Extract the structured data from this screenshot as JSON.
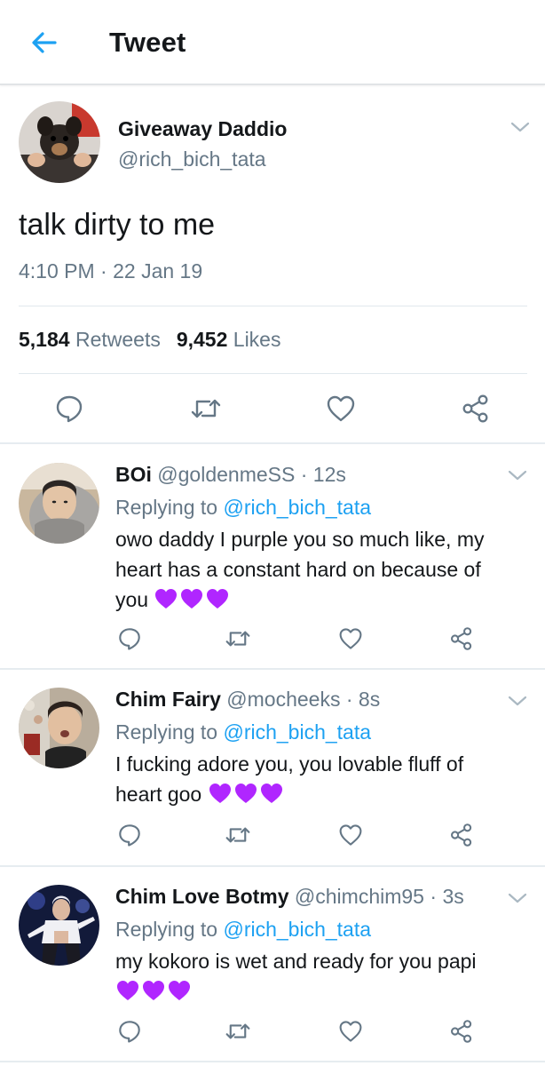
{
  "header": {
    "title": "Tweet",
    "back_icon": "arrow-left-icon"
  },
  "main_tweet": {
    "name": "Giveaway Daddio",
    "handle": "@rich_bich_tata",
    "text": "talk dirty to me",
    "time": "4:10 PM",
    "separator": "·",
    "date": "22 Jan 19",
    "retweets_count": "5,184",
    "retweets_label": "Retweets",
    "likes_count": "9,452",
    "likes_label": "Likes"
  },
  "replies": [
    {
      "name": "BOi",
      "handle": "@goldenmeSS",
      "age": "12s",
      "replying_prefix": "Replying to",
      "replying_handle": "@rich_bich_tata",
      "line1": "owo daddy I purple you so much like, my",
      "line2": "heart has a constant hard on because of",
      "line3": "you",
      "emoji": "purple-heart x3"
    },
    {
      "name": "Chim Fairy",
      "handle": "@mocheeks",
      "age": "8s",
      "replying_prefix": "Replying to",
      "replying_handle": "@rich_bich_tata",
      "line1": "I fucking adore you, you lovable fluff of",
      "line2": "heart goo",
      "emoji": "purple-heart x3"
    },
    {
      "name": "Chim Love Botmy",
      "handle": "@chimchim95",
      "age": "3s",
      "replying_prefix": "Replying to",
      "replying_handle": "@rich_bich_tata",
      "line1": "my kokoro is wet and ready for you papi",
      "emoji": "purple-heart x3"
    }
  ],
  "colors": {
    "accent": "#1da1f2",
    "muted": "#657786",
    "text": "#14171a",
    "heart_emoji": "#b026ff"
  }
}
